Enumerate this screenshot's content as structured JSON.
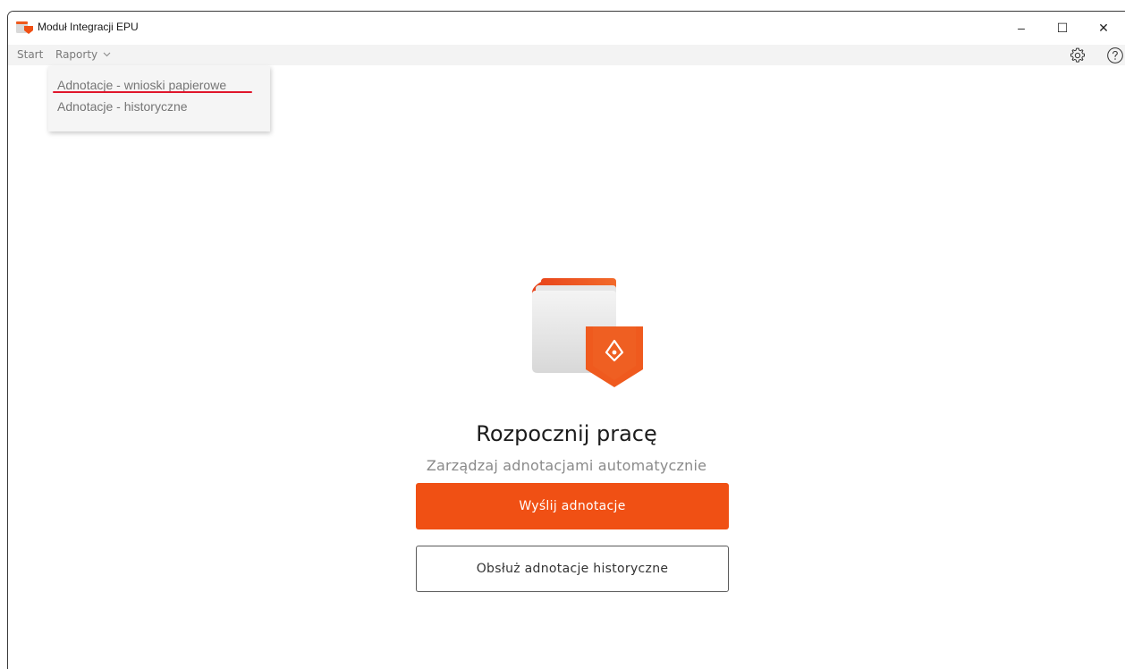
{
  "window": {
    "title": "Moduł Integracji EPU",
    "minimize_glyph": "–",
    "maximize_glyph": "☐",
    "close_glyph": "✕"
  },
  "menu": {
    "start_label": "Start",
    "raporty_label": "Raporty",
    "icons": [
      "gear-icon",
      "help-icon"
    ]
  },
  "dropdown": {
    "items": [
      {
        "label": "Adnotacje - wnioski papierowe"
      },
      {
        "label": "Adnotacje - historyczne"
      }
    ]
  },
  "main": {
    "heading": "Rozpocznij pracę",
    "subheading": "Zarządzaj adnotacjami automatycznie",
    "primary_button": "Wyślij adnotacje",
    "secondary_button": "Obsłuż adnotacje historyczne"
  },
  "colors": {
    "accent": "#f05014",
    "underline": "#e0162b"
  }
}
